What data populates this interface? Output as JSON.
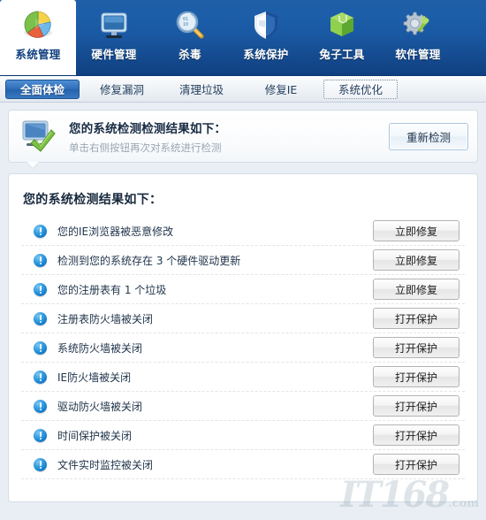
{
  "topnav": {
    "items": [
      {
        "label": "系统管理",
        "icon": "pie-chart-icon",
        "active": true
      },
      {
        "label": "硬件管理",
        "icon": "monitor-icon",
        "active": false
      },
      {
        "label": "杀毒",
        "icon": "magnifier-icon",
        "active": false
      },
      {
        "label": "系统保护",
        "icon": "shield-icon",
        "active": false
      },
      {
        "label": "兔子工具",
        "icon": "green-box-icon",
        "active": false
      },
      {
        "label": "软件管理",
        "icon": "gear-wrench-icon",
        "active": false
      }
    ]
  },
  "subtabs": {
    "items": [
      {
        "label": "全面体检",
        "state": "active"
      },
      {
        "label": "修复漏洞",
        "state": "normal"
      },
      {
        "label": "清理垃圾",
        "state": "normal"
      },
      {
        "label": "修复IE",
        "state": "normal"
      },
      {
        "label": "系统优化",
        "state": "focused"
      }
    ]
  },
  "banner": {
    "icon": "monitor-check-icon",
    "title": "您的系统检测检测结果如下：",
    "subtitle": "单击右侧按钮再次对系统进行检测",
    "rescan_label": "重新检测"
  },
  "panel": {
    "title": "您的系统检测结果如下：",
    "rows": [
      {
        "label": "您的IE浏览器被恶意修改",
        "button": "立即修复",
        "icon": "warning-icon"
      },
      {
        "label": "检测到您的系统存在 3 个硬件驱动更新",
        "button": "立即修复",
        "icon": "warning-icon"
      },
      {
        "label": "您的注册表有 1 个垃圾",
        "button": "立即修复",
        "icon": "warning-icon"
      },
      {
        "label": "注册表防火墙被关闭",
        "button": "打开保护",
        "icon": "warning-icon"
      },
      {
        "label": "系统防火墙被关闭",
        "button": "打开保护",
        "icon": "warning-icon"
      },
      {
        "label": "IE防火墙被关闭",
        "button": "打开保护",
        "icon": "warning-icon"
      },
      {
        "label": "驱动防火墙被关闭",
        "button": "打开保护",
        "icon": "warning-icon"
      },
      {
        "label": "时间保护被关闭",
        "button": "打开保护",
        "icon": "warning-icon"
      },
      {
        "label": "文件实时监控被关闭",
        "button": "打开保护",
        "icon": "warning-icon"
      }
    ]
  },
  "watermark": {
    "text": "IT168",
    "suffix": ".com"
  },
  "colors": {
    "nav_blue": "#1a59a3",
    "active_tab_blue": "#2f6db8",
    "warning_blue": "#2e9be0",
    "panel_bg": "#ffffff",
    "page_bg": "#e8eef4"
  }
}
